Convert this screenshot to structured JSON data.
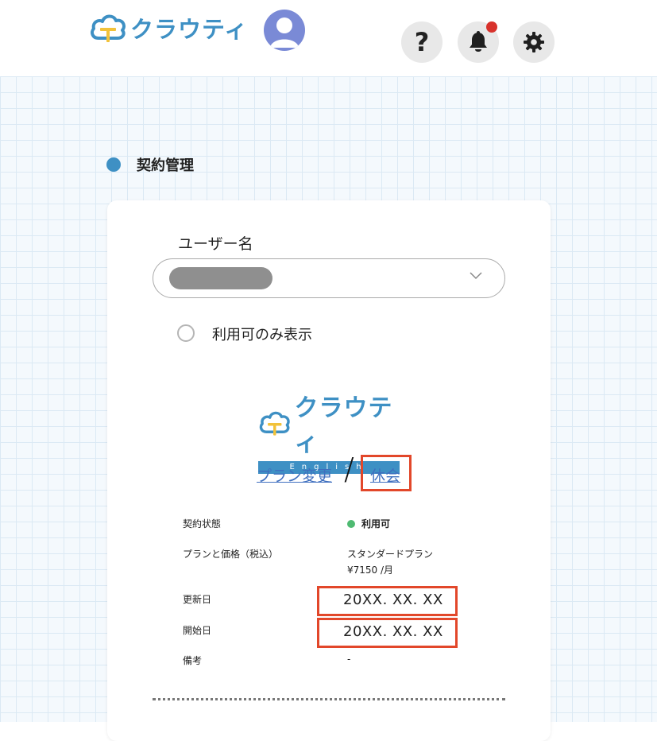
{
  "header": {
    "logo_text": "クラウティ",
    "icons": [
      "help-icon",
      "bell-icon",
      "gear-icon"
    ],
    "help_label": "?",
    "has_notification": true
  },
  "section": {
    "title": "契約管理"
  },
  "user": {
    "label": "ユーザー名",
    "selected_value": "",
    "filter_label": "利用可のみ表示",
    "filter_checked": false
  },
  "brand": {
    "name": "クラウティ",
    "subtitle": "English"
  },
  "links": {
    "plan_change": "プラン変更",
    "separator": "/",
    "suspend": "休会"
  },
  "details": {
    "status": {
      "label": "契約状態",
      "value": "利用可"
    },
    "plan": {
      "label": "プランと価格（税込）",
      "name": "スタンダードプラン",
      "price": "¥7150 /月"
    },
    "renewal": {
      "label": "更新日",
      "value": "20XX. XX. XX"
    },
    "start": {
      "label": "開始日",
      "value": "20XX. XX. XX"
    },
    "notes": {
      "label": "備考",
      "value": "-"
    }
  },
  "colors": {
    "brand_blue": "#3e90c4",
    "highlight_red": "#e2472a",
    "status_green": "#4fba72",
    "notification_red": "#d8322c",
    "link_blue": "#3f6fbf"
  }
}
